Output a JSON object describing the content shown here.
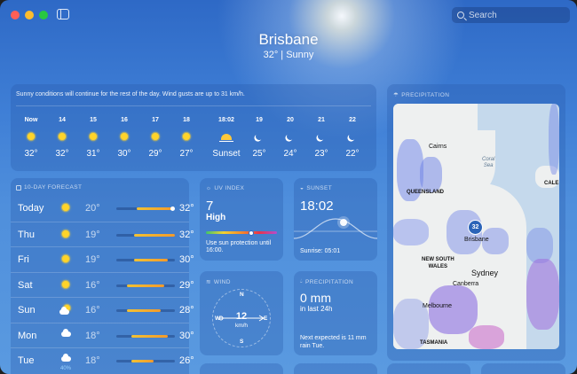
{
  "window": {
    "search_placeholder": "Search"
  },
  "header": {
    "city": "Brisbane",
    "condition": "32°  |  Sunny"
  },
  "hourly": {
    "summary": "Sunny conditions will continue for the rest of the day. Wind gusts are up to 31 km/h.",
    "hours": [
      {
        "time": "Now",
        "icon": "sun-icon",
        "value": "32°"
      },
      {
        "time": "14",
        "icon": "sun-icon",
        "value": "32°"
      },
      {
        "time": "15",
        "icon": "sun-icon",
        "value": "31°"
      },
      {
        "time": "16",
        "icon": "sun-icon",
        "value": "30°"
      },
      {
        "time": "17",
        "icon": "sun-icon",
        "value": "29°"
      },
      {
        "time": "18",
        "icon": "sun-icon",
        "value": "27°"
      },
      {
        "time": "18:02",
        "icon": "sunset-icon",
        "value": "Sunset"
      },
      {
        "time": "19",
        "icon": "moon-icon",
        "value": "25°"
      },
      {
        "time": "20",
        "icon": "moon-icon",
        "value": "24°"
      },
      {
        "time": "21",
        "icon": "moon-icon",
        "value": "23°"
      },
      {
        "time": "22",
        "icon": "moon-icon",
        "value": "22°"
      }
    ]
  },
  "forecast": {
    "title": "10-DAY FORECAST",
    "days": [
      {
        "day": "Today",
        "icon": "sun-icon",
        "low": "20°",
        "high": "32°",
        "sub": "",
        "range": [
          0.35,
          0.98
        ],
        "dot": 0.96
      },
      {
        "day": "Thu",
        "icon": "sun-icon",
        "low": "19°",
        "high": "32°",
        "sub": "",
        "range": [
          0.3,
          1.0
        ]
      },
      {
        "day": "Fri",
        "icon": "sun-icon",
        "low": "19°",
        "high": "30°",
        "sub": "",
        "range": [
          0.3,
          0.88
        ]
      },
      {
        "day": "Sat",
        "icon": "sun-icon",
        "low": "16°",
        "high": "29°",
        "sub": "",
        "range": [
          0.18,
          0.82
        ]
      },
      {
        "day": "Sun",
        "icon": "partly-cloudy-icon",
        "low": "16°",
        "high": "28°",
        "sub": "",
        "range": [
          0.18,
          0.76
        ]
      },
      {
        "day": "Mon",
        "icon": "cloud-icon",
        "low": "18°",
        "high": "30°",
        "sub": "",
        "range": [
          0.26,
          0.88
        ]
      },
      {
        "day": "Tue",
        "icon": "cloud-icon",
        "low": "18°",
        "high": "26°",
        "sub": "40%",
        "range": [
          0.26,
          0.64
        ]
      }
    ]
  },
  "uv": {
    "title": "UV INDEX",
    "value": "7",
    "level": "High",
    "fraction": 0.64,
    "note": "Use sun protection until 16:00."
  },
  "sunset": {
    "title": "SUNSET",
    "time": "18:02",
    "sunrise": "Sunrise: 05:01"
  },
  "wind": {
    "title": "WIND",
    "speed": "12",
    "unit": "km/h",
    "n": "N",
    "e": "E",
    "s": "S",
    "w": "W"
  },
  "precip": {
    "title": "PRECIPITATION",
    "value": "0 mm",
    "sub": "in last 24h",
    "note": "Next expected is 11 mm rain Tue."
  },
  "radar": {
    "title": "PRECIPITATION",
    "pin": "32",
    "labels": {
      "cairns": "Cairns",
      "coral_sea": "Coral\nSea",
      "queensland": "QUEENSLAND",
      "cale": "CALE",
      "brisbane": "Brisbane",
      "nsw": "NEW SOUTH\nWALES",
      "sydney": "Sydney",
      "canberra": "Canberra",
      "melbourne": "Melbourne",
      "tasmania": "TASMANIA"
    }
  },
  "colors": {
    "accent": "#2b64b8",
    "sun": "#ffd42a",
    "bar_start": "#f2c234",
    "bar_end": "#f39a2b"
  }
}
